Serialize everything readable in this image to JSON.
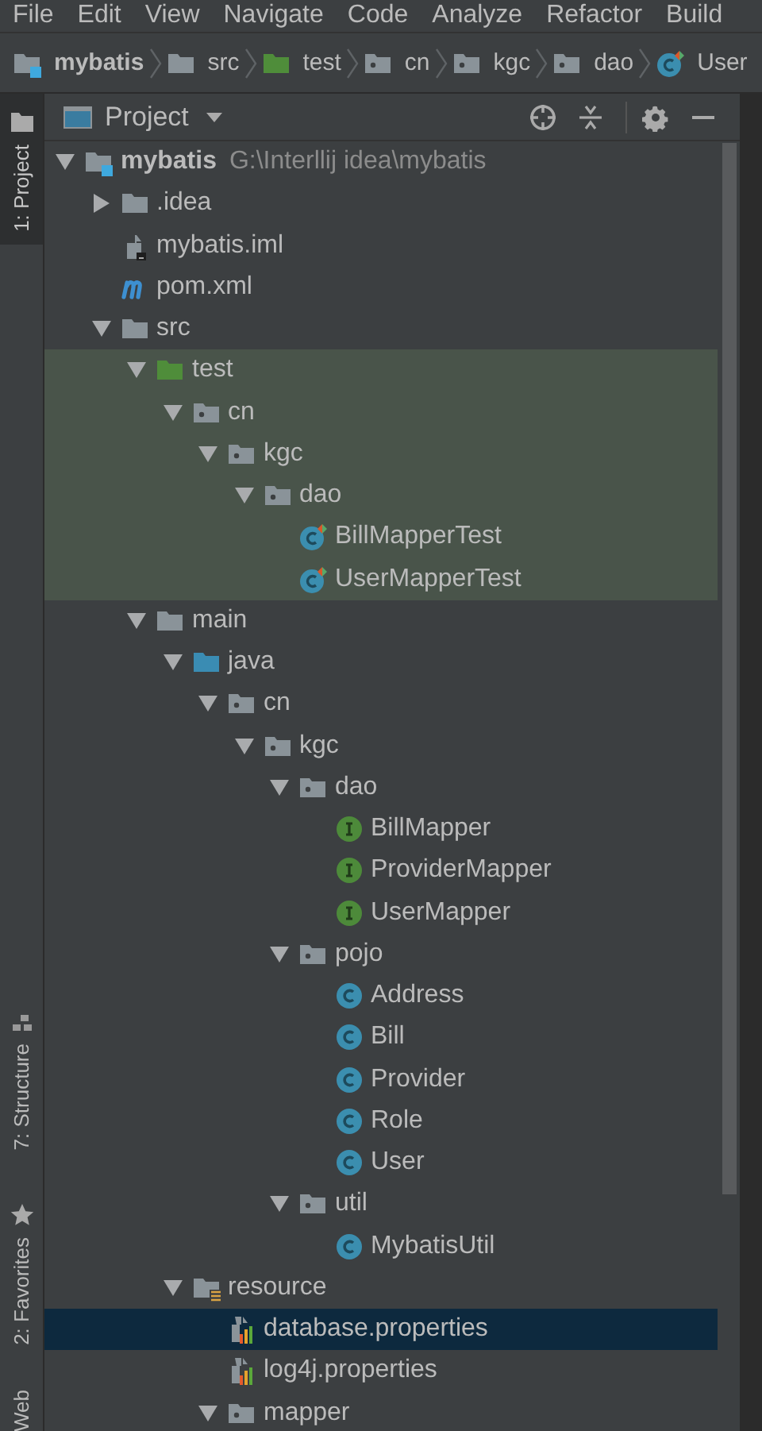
{
  "menu": [
    "File",
    "Edit",
    "View",
    "Navigate",
    "Code",
    "Analyze",
    "Refactor",
    "Build"
  ],
  "breadcrumb": [
    {
      "label": "mybatis",
      "kind": "module"
    },
    {
      "label": "src",
      "kind": "folder"
    },
    {
      "label": "test",
      "kind": "folder-test"
    },
    {
      "label": "cn",
      "kind": "package"
    },
    {
      "label": "kgc",
      "kind": "package"
    },
    {
      "label": "dao",
      "kind": "package"
    },
    {
      "label": "User",
      "kind": "class-test"
    }
  ],
  "side_tabs": [
    {
      "label": "1: Project",
      "kind": "project",
      "selected": true
    },
    {
      "label": "7: Structure",
      "kind": "structure",
      "selected": false
    },
    {
      "label": "2: Favorites",
      "kind": "favorites",
      "selected": false
    },
    {
      "label": "Web",
      "kind": "plain",
      "selected": false
    }
  ],
  "panel": {
    "title": "Project"
  },
  "tree": [
    {
      "label": "mybatis",
      "path": "G:\\Interllij idea\\mybatis",
      "kind": "module",
      "expanded": true,
      "selected": false,
      "highlighted": false,
      "children": [
        {
          "label": ".idea",
          "kind": "folder",
          "expanded": false,
          "selected": false,
          "highlighted": false
        },
        {
          "label": "mybatis.iml",
          "kind": "iml",
          "selected": false,
          "highlighted": false
        },
        {
          "label": "pom.xml",
          "kind": "maven",
          "selected": false,
          "highlighted": false
        },
        {
          "label": "src",
          "kind": "folder",
          "expanded": true,
          "selected": false,
          "highlighted": false,
          "children": [
            {
              "label": "test",
              "kind": "folder-test",
              "expanded": true,
              "selected": false,
              "highlighted": true,
              "children": [
                {
                  "label": "cn",
                  "kind": "package",
                  "expanded": true,
                  "selected": false,
                  "highlighted": true,
                  "children": [
                    {
                      "label": "kgc",
                      "kind": "package",
                      "expanded": true,
                      "selected": false,
                      "highlighted": true,
                      "children": [
                        {
                          "label": "dao",
                          "kind": "package",
                          "expanded": true,
                          "selected": false,
                          "highlighted": true,
                          "children": [
                            {
                              "label": "BillMapperTest",
                              "kind": "class-test",
                              "selected": false,
                              "highlighted": true
                            },
                            {
                              "label": "UserMapperTest",
                              "kind": "class-test",
                              "selected": false,
                              "highlighted": true
                            }
                          ]
                        }
                      ]
                    }
                  ]
                }
              ]
            },
            {
              "label": "main",
              "kind": "folder",
              "expanded": true,
              "selected": false,
              "highlighted": false,
              "children": [
                {
                  "label": "java",
                  "kind": "folder-source",
                  "expanded": true,
                  "selected": false,
                  "highlighted": false,
                  "children": [
                    {
                      "label": "cn",
                      "kind": "package",
                      "expanded": true,
                      "selected": false,
                      "highlighted": false,
                      "children": [
                        {
                          "label": "kgc",
                          "kind": "package",
                          "expanded": true,
                          "selected": false,
                          "highlighted": false,
                          "children": [
                            {
                              "label": "dao",
                              "kind": "package",
                              "expanded": true,
                              "selected": false,
                              "highlighted": false,
                              "children": [
                                {
                                  "label": "BillMapper",
                                  "kind": "interface",
                                  "selected": false,
                                  "highlighted": false
                                },
                                {
                                  "label": "ProviderMapper",
                                  "kind": "interface",
                                  "selected": false,
                                  "highlighted": false
                                },
                                {
                                  "label": "UserMapper",
                                  "kind": "interface",
                                  "selected": false,
                                  "highlighted": false
                                }
                              ]
                            },
                            {
                              "label": "pojo",
                              "kind": "package",
                              "expanded": true,
                              "selected": false,
                              "highlighted": false,
                              "children": [
                                {
                                  "label": "Address",
                                  "kind": "class",
                                  "selected": false,
                                  "highlighted": false
                                },
                                {
                                  "label": "Bill",
                                  "kind": "class",
                                  "selected": false,
                                  "highlighted": false
                                },
                                {
                                  "label": "Provider",
                                  "kind": "class",
                                  "selected": false,
                                  "highlighted": false
                                },
                                {
                                  "label": "Role",
                                  "kind": "class",
                                  "selected": false,
                                  "highlighted": false
                                },
                                {
                                  "label": "User",
                                  "kind": "class",
                                  "selected": false,
                                  "highlighted": false
                                }
                              ]
                            },
                            {
                              "label": "util",
                              "kind": "package",
                              "expanded": true,
                              "selected": false,
                              "highlighted": false,
                              "children": [
                                {
                                  "label": "MybatisUtil",
                                  "kind": "class",
                                  "selected": false,
                                  "highlighted": false
                                }
                              ]
                            }
                          ]
                        }
                      ]
                    }
                  ]
                },
                {
                  "label": "resource",
                  "kind": "folder-resource",
                  "expanded": true,
                  "selected": false,
                  "highlighted": false,
                  "children": [
                    {
                      "label": "database.properties",
                      "kind": "properties",
                      "selected": true,
                      "highlighted": false
                    },
                    {
                      "label": "log4j.properties",
                      "kind": "properties",
                      "selected": false,
                      "highlighted": false
                    },
                    {
                      "label": "mapper",
                      "kind": "package",
                      "expanded": true,
                      "selected": false,
                      "highlighted": false
                    }
                  ]
                }
              ]
            }
          ]
        }
      ]
    }
  ]
}
